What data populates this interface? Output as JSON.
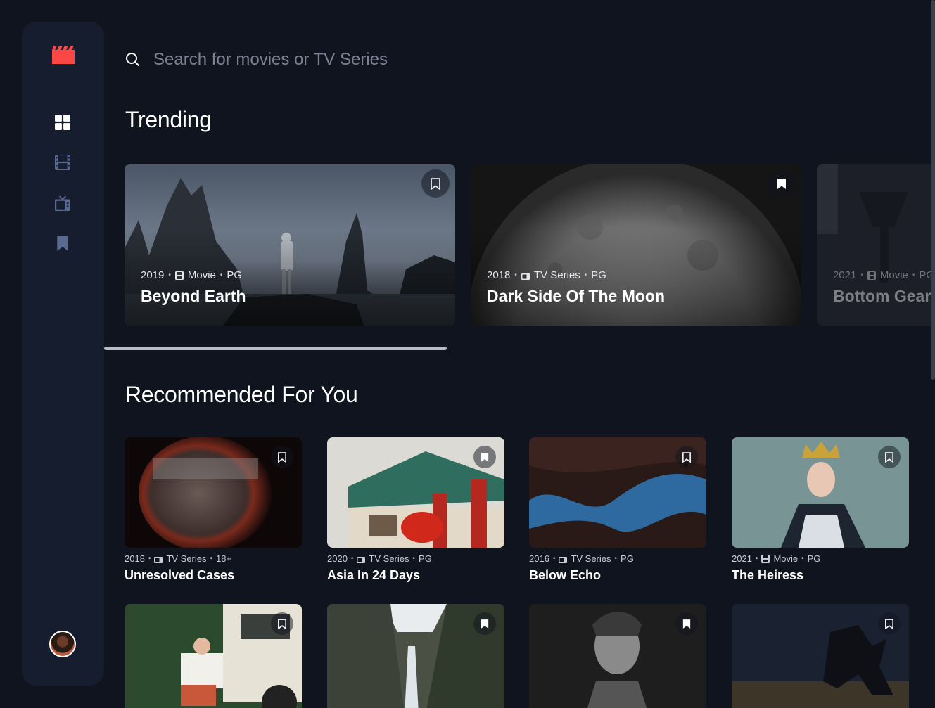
{
  "search": {
    "placeholder": "Search for movies or TV Series"
  },
  "sections": {
    "trending": "Trending",
    "recommended": "Recommended For You"
  },
  "colors": {
    "background": "#10141e",
    "sidebar": "#161d2f",
    "accent": "#fc4747",
    "nav_active": "#ffffff",
    "nav_inactive": "#5a698f"
  },
  "sidebar": {
    "items": [
      {
        "icon": "grid-icon",
        "label": "Home",
        "active": true
      },
      {
        "icon": "film-icon",
        "label": "Movies",
        "active": false
      },
      {
        "icon": "tv-icon",
        "label": "TV Series",
        "active": false
      },
      {
        "icon": "bookmark-icon",
        "label": "Bookmarks",
        "active": false
      }
    ]
  },
  "trending": [
    {
      "year": "2019",
      "category": "Movie",
      "rating": "PG",
      "title": "Beyond Earth",
      "bookmarked": false
    },
    {
      "year": "2018",
      "category": "TV Series",
      "rating": "PG",
      "title": "Dark Side Of The Moon",
      "bookmarked": true
    },
    {
      "year": "2021",
      "category": "Movie",
      "rating": "PG",
      "title": "Bottom Gear",
      "bookmarked": false
    }
  ],
  "recommended": [
    {
      "year": "2018",
      "category": "TV Series",
      "rating": "18+",
      "title": "Unresolved Cases",
      "bookmarked": false
    },
    {
      "year": "2020",
      "category": "TV Series",
      "rating": "PG",
      "title": "Asia In 24 Days",
      "bookmarked": true
    },
    {
      "year": "2016",
      "category": "TV Series",
      "rating": "PG",
      "title": "Below Echo",
      "bookmarked": false
    },
    {
      "year": "2021",
      "category": "Movie",
      "rating": "PG",
      "title": "The Heiress",
      "bookmarked": false
    },
    {
      "bookmarked": false
    },
    {
      "bookmarked": true
    },
    {
      "bookmarked": true
    },
    {
      "bookmarked": false
    }
  ]
}
